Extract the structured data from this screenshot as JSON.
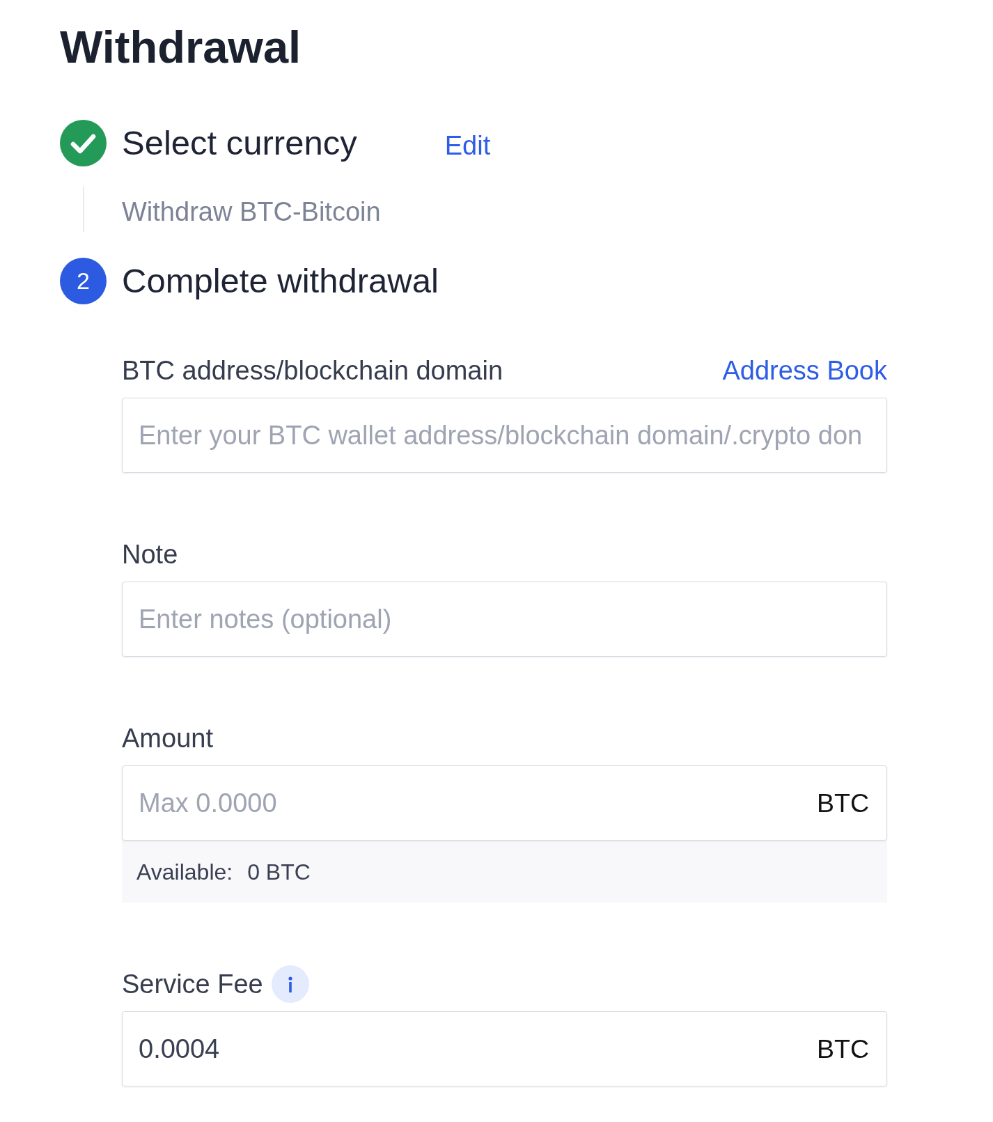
{
  "title": "Withdrawal",
  "steps": [
    {
      "completed": true,
      "title": "Select currency",
      "action": "Edit",
      "summary": "Withdraw BTC-Bitcoin"
    },
    {
      "completed": false,
      "number": "2",
      "title": "Complete withdrawal"
    }
  ],
  "fields": [
    {
      "label": "BTC address/blockchain domain",
      "link": "Address Book",
      "placeholder": "Enter your BTC wallet address/blockchain domain/.crypto don"
    },
    {
      "label": "Note",
      "placeholder": "Enter notes (optional)"
    },
    {
      "label": "Amount",
      "placeholder": "Max 0.0000",
      "suffix": "BTC",
      "available": {
        "label": "Available:",
        "value": "0 BTC"
      }
    },
    {
      "label": "Service Fee",
      "info": true,
      "value": "0.0004",
      "suffix": "BTC"
    }
  ]
}
